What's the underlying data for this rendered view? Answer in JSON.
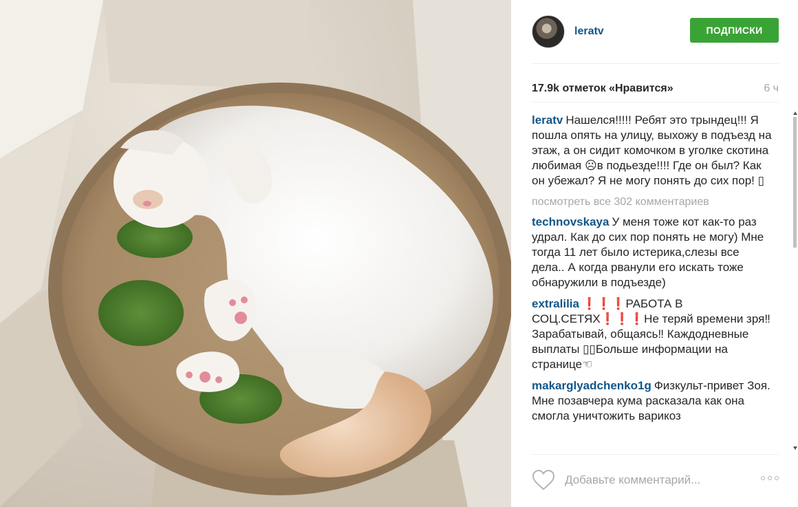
{
  "post": {
    "username": "leratv",
    "follow_label": "ПОДПИСКИ",
    "likes": "17.9k отметок «Нравится»",
    "time": "6 ч",
    "caption": {
      "user": "leratv",
      "text": "Нашелся!!!!! Ребят это трындец!!! Я пошла опять на улицу, выхожу в подъезд на этаж, а он сидит комочком в уголке скотина любимая ☹в подьезде!!!! Где он был? Как он убежал? Я не могу понять до сих пор! ▯"
    },
    "view_all": "посмотреть все 302 комментариев",
    "comments": [
      {
        "user": "technovskaya",
        "text": "У меня тоже кот как-то раз удрал. Как до сих пор понять не могу) Мне тогда 11 лет было истерика,слезы все дела.. А когда рванули его искать тоже обнаружили в подъезде)"
      },
      {
        "user": "extralilia",
        "text": "❗❗❗РАБОТА В СОЦ.СЕТЯХ❗❗❗Не теряй времени зря‼Зарабатывай, общаясь‼ Каждодневные выплаты ▯▯Больше информации на странице☜"
      },
      {
        "user": "makarglyadchenko1g",
        "text": "Физкульт-привет Зоя. Мне позавчера кума расказала как она смогла уничтожить варикоз"
      }
    ],
    "comment_placeholder": "Добавьте комментарий...",
    "icons": {
      "like": "heart-icon",
      "more": "more-icon"
    },
    "colors": {
      "follow_button": "#3aa336",
      "username": "#125688",
      "muted": "#a5a7aa"
    }
  }
}
